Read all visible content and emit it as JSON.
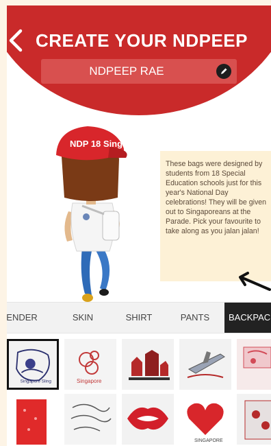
{
  "header": {
    "title": "CREATE YOUR NDPEEP",
    "name_value": "NDPEEP RAE"
  },
  "info_text": "These bags were designed by students from 18 Special Education schools just for this year's National Day celebrations! They will be given out to Singaporeans at the Parade. Pick your favourite to take along as you jalan jalan!",
  "avatar": {
    "cap_text": "NDP 18 Sing"
  },
  "tabs": [
    {
      "label": "GENDER"
    },
    {
      "label": "SKIN"
    },
    {
      "label": "SHIRT"
    },
    {
      "label": "PANTS"
    },
    {
      "label": "BACKPACK",
      "selected": true
    }
  ],
  "bag_items": [
    {
      "caption": "Singapore Sling",
      "selected": true
    },
    {
      "caption": "Singapore"
    },
    {
      "caption": ""
    },
    {
      "caption": ""
    },
    {
      "caption": ""
    },
    {
      "caption": ""
    },
    {
      "caption": ""
    },
    {
      "caption": ""
    },
    {
      "caption": "SINGAPORE"
    },
    {
      "caption": ""
    }
  ],
  "colors": {
    "brand_red": "#c92a2a",
    "tab_active": "#222222",
    "info_bg": "#fdf1d6"
  }
}
